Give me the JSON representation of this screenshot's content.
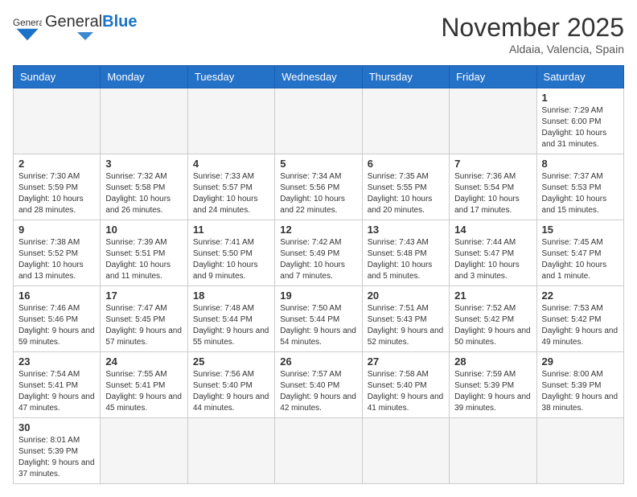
{
  "header": {
    "logo_general": "General",
    "logo_blue": "Blue",
    "month_title": "November 2025",
    "location": "Aldaia, Valencia, Spain"
  },
  "calendar": {
    "days_of_week": [
      "Sunday",
      "Monday",
      "Tuesday",
      "Wednesday",
      "Thursday",
      "Friday",
      "Saturday"
    ],
    "weeks": [
      [
        {
          "day": "",
          "info": ""
        },
        {
          "day": "",
          "info": ""
        },
        {
          "day": "",
          "info": ""
        },
        {
          "day": "",
          "info": ""
        },
        {
          "day": "",
          "info": ""
        },
        {
          "day": "",
          "info": ""
        },
        {
          "day": "1",
          "info": "Sunrise: 7:29 AM\nSunset: 6:00 PM\nDaylight: 10 hours and 31 minutes."
        }
      ],
      [
        {
          "day": "2",
          "info": "Sunrise: 7:30 AM\nSunset: 5:59 PM\nDaylight: 10 hours and 28 minutes."
        },
        {
          "day": "3",
          "info": "Sunrise: 7:32 AM\nSunset: 5:58 PM\nDaylight: 10 hours and 26 minutes."
        },
        {
          "day": "4",
          "info": "Sunrise: 7:33 AM\nSunset: 5:57 PM\nDaylight: 10 hours and 24 minutes."
        },
        {
          "day": "5",
          "info": "Sunrise: 7:34 AM\nSunset: 5:56 PM\nDaylight: 10 hours and 22 minutes."
        },
        {
          "day": "6",
          "info": "Sunrise: 7:35 AM\nSunset: 5:55 PM\nDaylight: 10 hours and 20 minutes."
        },
        {
          "day": "7",
          "info": "Sunrise: 7:36 AM\nSunset: 5:54 PM\nDaylight: 10 hours and 17 minutes."
        },
        {
          "day": "8",
          "info": "Sunrise: 7:37 AM\nSunset: 5:53 PM\nDaylight: 10 hours and 15 minutes."
        }
      ],
      [
        {
          "day": "9",
          "info": "Sunrise: 7:38 AM\nSunset: 5:52 PM\nDaylight: 10 hours and 13 minutes."
        },
        {
          "day": "10",
          "info": "Sunrise: 7:39 AM\nSunset: 5:51 PM\nDaylight: 10 hours and 11 minutes."
        },
        {
          "day": "11",
          "info": "Sunrise: 7:41 AM\nSunset: 5:50 PM\nDaylight: 10 hours and 9 minutes."
        },
        {
          "day": "12",
          "info": "Sunrise: 7:42 AM\nSunset: 5:49 PM\nDaylight: 10 hours and 7 minutes."
        },
        {
          "day": "13",
          "info": "Sunrise: 7:43 AM\nSunset: 5:48 PM\nDaylight: 10 hours and 5 minutes."
        },
        {
          "day": "14",
          "info": "Sunrise: 7:44 AM\nSunset: 5:47 PM\nDaylight: 10 hours and 3 minutes."
        },
        {
          "day": "15",
          "info": "Sunrise: 7:45 AM\nSunset: 5:47 PM\nDaylight: 10 hours and 1 minute."
        }
      ],
      [
        {
          "day": "16",
          "info": "Sunrise: 7:46 AM\nSunset: 5:46 PM\nDaylight: 9 hours and 59 minutes."
        },
        {
          "day": "17",
          "info": "Sunrise: 7:47 AM\nSunset: 5:45 PM\nDaylight: 9 hours and 57 minutes."
        },
        {
          "day": "18",
          "info": "Sunrise: 7:48 AM\nSunset: 5:44 PM\nDaylight: 9 hours and 55 minutes."
        },
        {
          "day": "19",
          "info": "Sunrise: 7:50 AM\nSunset: 5:44 PM\nDaylight: 9 hours and 54 minutes."
        },
        {
          "day": "20",
          "info": "Sunrise: 7:51 AM\nSunset: 5:43 PM\nDaylight: 9 hours and 52 minutes."
        },
        {
          "day": "21",
          "info": "Sunrise: 7:52 AM\nSunset: 5:42 PM\nDaylight: 9 hours and 50 minutes."
        },
        {
          "day": "22",
          "info": "Sunrise: 7:53 AM\nSunset: 5:42 PM\nDaylight: 9 hours and 49 minutes."
        }
      ],
      [
        {
          "day": "23",
          "info": "Sunrise: 7:54 AM\nSunset: 5:41 PM\nDaylight: 9 hours and 47 minutes."
        },
        {
          "day": "24",
          "info": "Sunrise: 7:55 AM\nSunset: 5:41 PM\nDaylight: 9 hours and 45 minutes."
        },
        {
          "day": "25",
          "info": "Sunrise: 7:56 AM\nSunset: 5:40 PM\nDaylight: 9 hours and 44 minutes."
        },
        {
          "day": "26",
          "info": "Sunrise: 7:57 AM\nSunset: 5:40 PM\nDaylight: 9 hours and 42 minutes."
        },
        {
          "day": "27",
          "info": "Sunrise: 7:58 AM\nSunset: 5:40 PM\nDaylight: 9 hours and 41 minutes."
        },
        {
          "day": "28",
          "info": "Sunrise: 7:59 AM\nSunset: 5:39 PM\nDaylight: 9 hours and 39 minutes."
        },
        {
          "day": "29",
          "info": "Sunrise: 8:00 AM\nSunset: 5:39 PM\nDaylight: 9 hours and 38 minutes."
        }
      ],
      [
        {
          "day": "30",
          "info": "Sunrise: 8:01 AM\nSunset: 5:39 PM\nDaylight: 9 hours and 37 minutes."
        },
        {
          "day": "",
          "info": ""
        },
        {
          "day": "",
          "info": ""
        },
        {
          "day": "",
          "info": ""
        },
        {
          "day": "",
          "info": ""
        },
        {
          "day": "",
          "info": ""
        },
        {
          "day": "",
          "info": ""
        }
      ]
    ]
  }
}
